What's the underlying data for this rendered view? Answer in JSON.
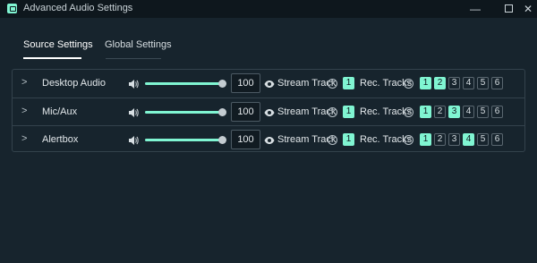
{
  "window": {
    "title": "Advanced Audio Settings",
    "minimize": "—",
    "close": "✕"
  },
  "tabs": [
    {
      "label": "Source Settings",
      "active": true
    },
    {
      "label": "Global Settings",
      "active": false
    }
  ],
  "labels": {
    "stream_track": "Stream Track",
    "rec_tracks": "Rec. Tracks",
    "help": "?"
  },
  "colors": {
    "accent": "#80f5d2",
    "background": "#17242d",
    "titlebar": "#0e171d"
  },
  "sources": [
    {
      "name": "Desktop Audio",
      "volume": "100",
      "volume_level": 1.0,
      "stream_track": "1",
      "rec_tracks": [
        "1",
        "2",
        "3",
        "4",
        "5",
        "6"
      ],
      "rec_active": [
        true,
        true,
        false,
        false,
        false,
        false
      ]
    },
    {
      "name": "Mic/Aux",
      "volume": "100",
      "volume_level": 1.0,
      "stream_track": "1",
      "rec_tracks": [
        "1",
        "2",
        "3",
        "4",
        "5",
        "6"
      ],
      "rec_active": [
        true,
        false,
        true,
        false,
        false,
        false
      ]
    },
    {
      "name": "Alertbox",
      "volume": "100",
      "volume_level": 1.0,
      "stream_track": "1",
      "rec_tracks": [
        "1",
        "2",
        "3",
        "4",
        "5",
        "6"
      ],
      "rec_active": [
        true,
        false,
        false,
        true,
        false,
        false
      ]
    }
  ],
  "icons": {
    "app": "streamlabs-icon",
    "expand": "chevron-right-icon",
    "volume": "speaker-icon",
    "visibility": "eye-icon",
    "help": "help-circle-icon"
  }
}
